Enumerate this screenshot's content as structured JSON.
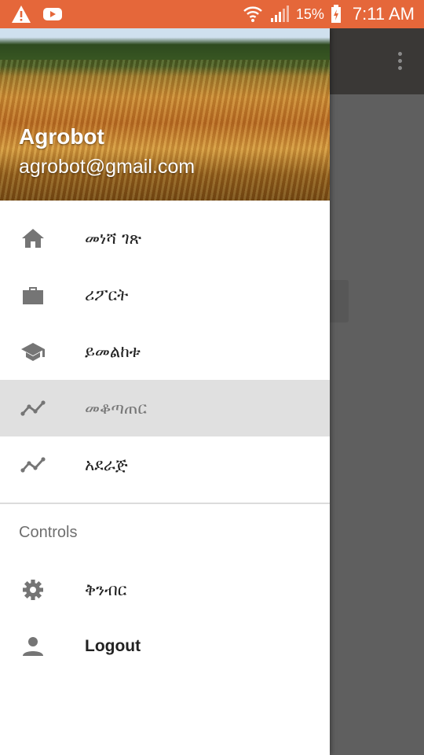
{
  "status_bar": {
    "icons": [
      "warning-icon",
      "youtube-icon",
      "wifi-icon",
      "signal-icon",
      "battery-icon"
    ],
    "battery": "15%",
    "time": "7:11 AM"
  },
  "drawer": {
    "header": {
      "name": "Agrobot",
      "email": "agrobot@gmail.com"
    },
    "items": [
      {
        "icon": "home-icon",
        "label": "መነሻ ገጽ"
      },
      {
        "icon": "briefcase-icon",
        "label": "ሪፖርት"
      },
      {
        "icon": "school-icon",
        "label": "ይመልከቱ"
      },
      {
        "icon": "trending-icon",
        "label": "መቆጣጠር",
        "selected": true
      },
      {
        "icon": "trending-icon",
        "label": "አደራጅ"
      }
    ],
    "section_title": "Controls",
    "controls": [
      {
        "icon": "gear-icon",
        "label": "ቅንብር"
      },
      {
        "icon": "person-icon",
        "label": "Logout"
      }
    ]
  },
  "colors": {
    "status_bar": "#e5673a",
    "toolbar": "#3a3836",
    "scrim": "#5f5f5f",
    "selected": "#e0e0e0"
  }
}
